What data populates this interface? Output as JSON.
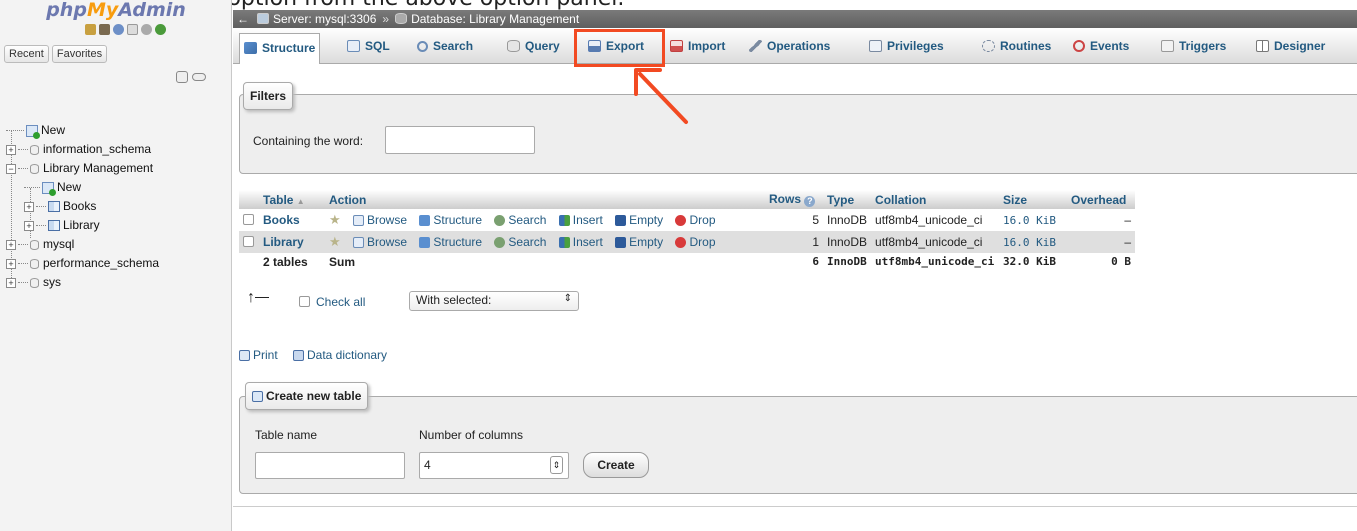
{
  "caption": "over to the \"Export\" option from the above option panel.",
  "logo": {
    "php": "php",
    "my": "My",
    "admin": "Admin"
  },
  "nav": {
    "tabs": [
      "Recent",
      "Favorites"
    ],
    "tree": [
      {
        "label": "New",
        "kind": "new"
      },
      {
        "label": "information_schema",
        "kind": "db"
      },
      {
        "label": "Library Management",
        "kind": "db-open"
      },
      {
        "label": "New",
        "kind": "new-child"
      },
      {
        "label": "Books",
        "kind": "table"
      },
      {
        "label": "Library",
        "kind": "table"
      },
      {
        "label": "mysql",
        "kind": "db"
      },
      {
        "label": "performance_schema",
        "kind": "db"
      },
      {
        "label": "sys",
        "kind": "db"
      }
    ]
  },
  "breadcrumb": {
    "server": "Server: mysql:3306",
    "sep": "»",
    "database": "Database: Library Management"
  },
  "menu": [
    "Structure",
    "SQL",
    "Search",
    "Query",
    "Export",
    "Import",
    "Operations",
    "Privileges",
    "Routines",
    "Events",
    "Triggers",
    "Designer"
  ],
  "filters": {
    "legend": "Filters",
    "label": "Containing the word:",
    "value": ""
  },
  "table": {
    "headers": {
      "table": "Table",
      "action": "Action",
      "rows": "Rows",
      "type": "Type",
      "collation": "Collation",
      "size": "Size",
      "overhead": "Overhead"
    },
    "actions": [
      "Browse",
      "Structure",
      "Search",
      "Insert",
      "Empty",
      "Drop"
    ],
    "rows": [
      {
        "name": "Books",
        "rows": "5",
        "type": "InnoDB",
        "collation": "utf8mb4_unicode_ci",
        "size": "16.0 KiB",
        "overhead": "–"
      },
      {
        "name": "Library",
        "rows": "1",
        "type": "InnoDB",
        "collation": "utf8mb4_unicode_ci",
        "size": "16.0 KiB",
        "overhead": "–"
      }
    ],
    "footer": {
      "name": "2 tables",
      "label": "Sum",
      "rows": "6",
      "type": "InnoDB",
      "collation": "utf8mb4_unicode_ci",
      "size": "32.0 KiB",
      "overhead": "0 B"
    }
  },
  "bulk": {
    "check_all": "Check all",
    "with_selected": "With selected:"
  },
  "links": {
    "print": "Print",
    "dictionary": "Data dictionary"
  },
  "create": {
    "legend": "Create new table",
    "name_label": "Table name",
    "name_value": "",
    "cols_label": "Number of columns",
    "cols_value": "4",
    "button": "Create"
  },
  "colors": {
    "accent": "#235a81",
    "highlight": "#f24a22"
  }
}
